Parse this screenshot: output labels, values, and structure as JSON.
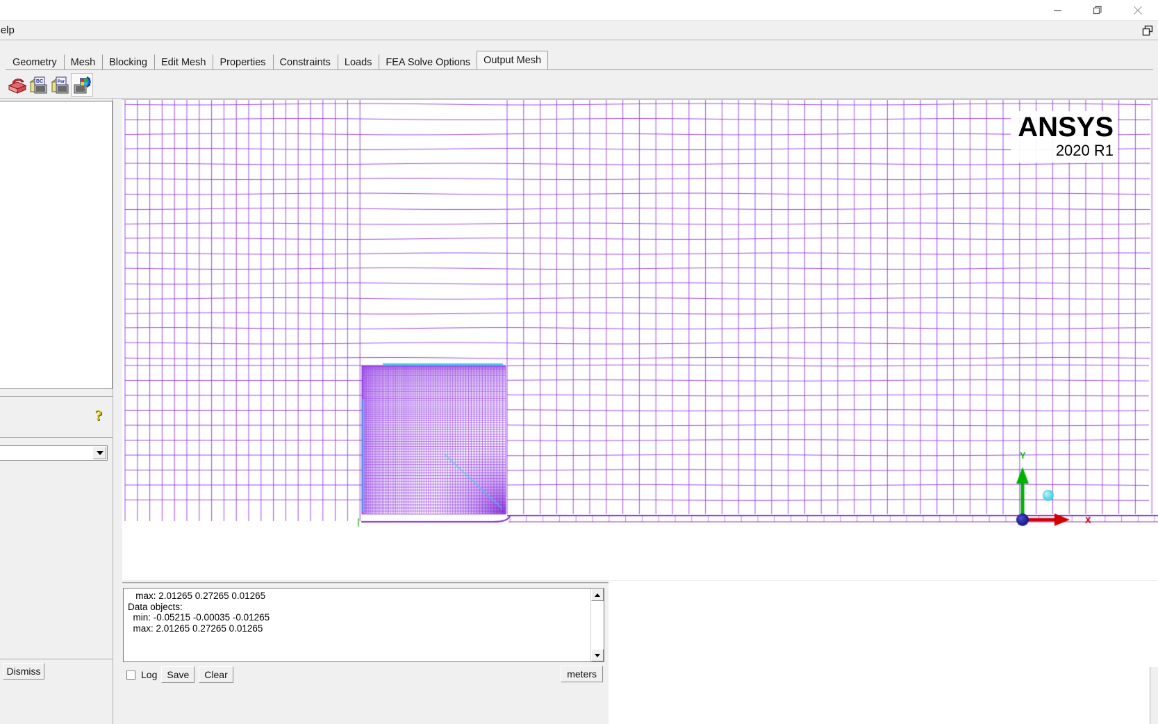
{
  "window": {
    "minimize_label": "minimize",
    "restore_label": "restore",
    "close_label": "close"
  },
  "menubar": {
    "items": [
      "Help"
    ],
    "restore_panel_label": "restore-panel"
  },
  "tabs": [
    {
      "label": "Geometry",
      "active": false
    },
    {
      "label": "Mesh",
      "active": false
    },
    {
      "label": "Blocking",
      "active": false
    },
    {
      "label": "Edit Mesh",
      "active": false
    },
    {
      "label": "Properties",
      "active": false
    },
    {
      "label": "Constraints",
      "active": false
    },
    {
      "label": "Loads",
      "active": false
    },
    {
      "label": "FEA Solve Options",
      "active": false
    },
    {
      "label": "Output Mesh",
      "active": true
    }
  ],
  "toolbar": {
    "icons": [
      {
        "name": "select-solver-icon",
        "selected": false
      },
      {
        "name": "write-bc-file-icon",
        "selected": false
      },
      {
        "name": "write-par-file-icon",
        "selected": false
      },
      {
        "name": "write-input-icon",
        "selected": true
      }
    ]
  },
  "left_panel": {
    "tree_items": [],
    "help_icon": "question-mark-icon",
    "combo_value": "",
    "dismiss_label": "Dismiss"
  },
  "viewport": {
    "logo_title": "ANSYS",
    "logo_version": "2020 R1",
    "axis_triad": {
      "x_label": "X",
      "y_label": "Y"
    },
    "colors": {
      "mesh_line": "#8a2be2",
      "mesh_line_light": "#b07cf0",
      "highlight_edge": "#2fd0ef",
      "axis_x": "#d40000",
      "axis_y": "#00b000",
      "axis_origin": "#1010a0",
      "point_marker": "#40d8e8"
    }
  },
  "messages": {
    "lines": [
      "   max: 2.01265 0.27265 0.01265",
      "Data objects:",
      "  min: -0.05215 -0.00035 -0.01265",
      "  max: 2.01265 0.27265 0.01265"
    ],
    "log_label": "Log",
    "save_label": "Save",
    "clear_label": "Clear",
    "units_label": "meters"
  }
}
